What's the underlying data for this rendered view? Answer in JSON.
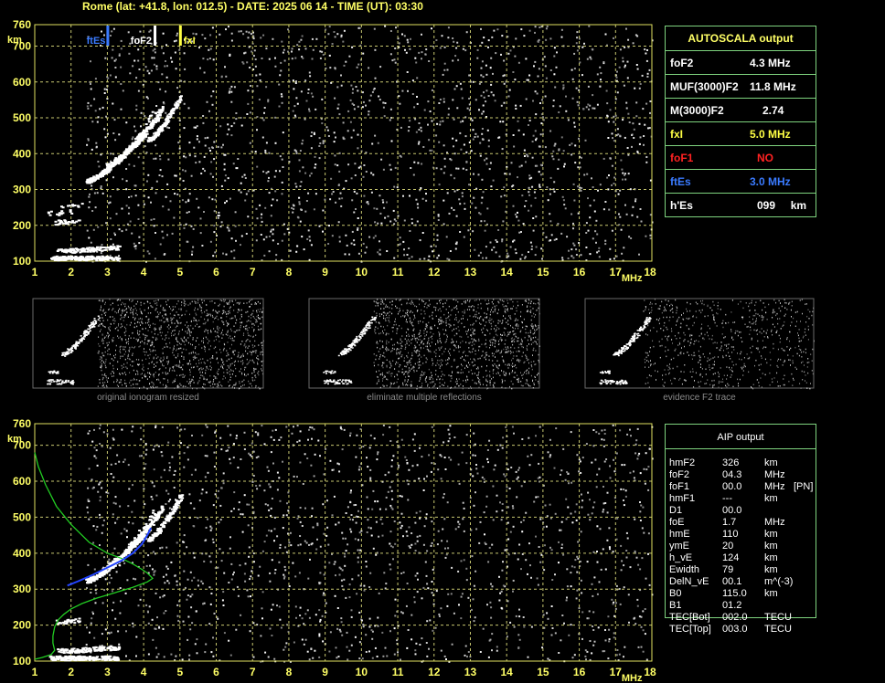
{
  "title": "Rome (lat: +41.8, lon: 012.5) - DATE: 2025 06 14 - TIME (UT): 03:30",
  "chart_data": [
    {
      "type": "scatter",
      "name": "ionogram-top",
      "xlabel": "MHz",
      "ylabel": "km",
      "xlim": [
        1,
        18
      ],
      "ylim": [
        100,
        760
      ],
      "x_ticks": [
        1,
        2,
        3,
        4,
        5,
        6,
        7,
        8,
        9,
        10,
        11,
        12,
        13,
        14,
        15,
        16,
        17,
        18
      ],
      "y_ticks": [
        100,
        200,
        300,
        400,
        500,
        600,
        700,
        760
      ],
      "markers": [
        {
          "label": "ftEs",
          "x": 3.0,
          "color": "#3a7bff"
        },
        {
          "label": "foF2",
          "x": 4.3,
          "color": "#ffffff"
        },
        {
          "label": "fxI",
          "x": 5.0,
          "color": "#ffff44"
        }
      ]
    },
    {
      "type": "scatter",
      "name": "ionogram-bottom",
      "xlabel": "MHz",
      "ylabel": "km",
      "xlim": [
        1,
        18
      ],
      "ylim": [
        100,
        760
      ],
      "x_ticks": [
        1,
        2,
        3,
        4,
        5,
        6,
        7,
        8,
        9,
        10,
        11,
        12,
        13,
        14,
        15,
        16,
        17,
        18
      ],
      "y_ticks": [
        100,
        200,
        300,
        400,
        500,
        600,
        700,
        760
      ],
      "series": [
        {
          "color": "#22cc22",
          "points": [
            [
              1.0,
              680
            ],
            [
              1.1,
              640
            ],
            [
              1.3,
              590
            ],
            [
              1.6,
              530
            ],
            [
              2.0,
              480
            ],
            [
              2.5,
              430
            ],
            [
              3.0,
              400
            ],
            [
              3.4,
              385
            ],
            [
              3.7,
              370
            ],
            [
              3.95,
              355
            ],
            [
              4.1,
              345
            ],
            [
              4.25,
              330
            ],
            [
              4.1,
              320
            ],
            [
              3.7,
              305
            ],
            [
              3.2,
              290
            ],
            [
              2.7,
              275
            ],
            [
              2.3,
              260
            ],
            [
              2.0,
              245
            ],
            [
              1.8,
              230
            ],
            [
              1.65,
              215
            ],
            [
              1.55,
              195
            ],
            [
              1.5,
              170
            ],
            [
              1.5,
              150
            ],
            [
              1.55,
              130
            ],
            [
              1.45,
              118
            ],
            [
              1.2,
              110
            ],
            [
              1.0,
              105
            ]
          ]
        },
        {
          "color": "#2244ff",
          "points": [
            [
              1.9,
              310
            ],
            [
              2.2,
              322
            ],
            [
              2.6,
              340
            ],
            [
              3.0,
              360
            ],
            [
              3.4,
              380
            ],
            [
              3.7,
              400
            ],
            [
              3.95,
              425
            ],
            [
              4.1,
              450
            ],
            [
              4.2,
              470
            ]
          ]
        }
      ]
    }
  ],
  "autoscala": {
    "title": "AUTOSCALA output",
    "rows": [
      {
        "label": "foF2",
        "value": "4.3 MHz",
        "color": "#ffffff"
      },
      {
        "label": "MUF(3000)F2",
        "value": "11.8 MHz",
        "color": "#ffffff"
      },
      {
        "label": "M(3000)F2",
        "value": "2.74",
        "color": "#ffffff"
      },
      {
        "label": "fxI",
        "value": "5.0 MHz",
        "color": "#ffff44"
      },
      {
        "label": "foF1",
        "value": "NO",
        "color": "#ff2222"
      },
      {
        "label": "ftEs",
        "value": "3.0 MHz",
        "color": "#3a7bff"
      },
      {
        "label": "h'Es",
        "value": "099     km",
        "color": "#ffffff"
      }
    ]
  },
  "thumbnails": [
    {
      "label": "original ionogram resized"
    },
    {
      "label": "eliminate multiple reflections"
    },
    {
      "label": "evidence F2 trace"
    }
  ],
  "aip": {
    "title": "AIP output",
    "rows": [
      {
        "label": "hmF2",
        "value": "326",
        "unit": "km",
        "extra": ""
      },
      {
        "label": "foF2",
        "value": "04.3",
        "unit": "MHz",
        "extra": ""
      },
      {
        "label": "foF1",
        "value": "00.0",
        "unit": "MHz",
        "extra": "[PN]"
      },
      {
        "label": "hmF1",
        "value": "---",
        "unit": "km",
        "extra": ""
      },
      {
        "label": "D1",
        "value": "00.0",
        "unit": "",
        "extra": ""
      },
      {
        "label": "foE",
        "value": "1.7",
        "unit": "MHz",
        "extra": ""
      },
      {
        "label": "hmE",
        "value": "110",
        "unit": "km",
        "extra": ""
      },
      {
        "label": "ymE",
        "value": "20",
        "unit": "km",
        "extra": ""
      },
      {
        "label": "h_vE",
        "value": "124",
        "unit": "km",
        "extra": ""
      },
      {
        "label": "Ewidth",
        "value": "79",
        "unit": "km",
        "extra": ""
      },
      {
        "label": "DelN_vE",
        "value": "00.1",
        "unit": "m^(-3)",
        "extra": ""
      },
      {
        "label": "B0",
        "value": "115.0",
        "unit": "km",
        "extra": ""
      },
      {
        "label": "B1",
        "value": "01.2",
        "unit": "",
        "extra": ""
      },
      {
        "label": "TEC[Bot]",
        "value": "002.0",
        "unit": "TECU",
        "extra": ""
      },
      {
        "label": "TEC[Top]",
        "value": "003.0",
        "unit": "TECU",
        "extra": ""
      }
    ]
  }
}
